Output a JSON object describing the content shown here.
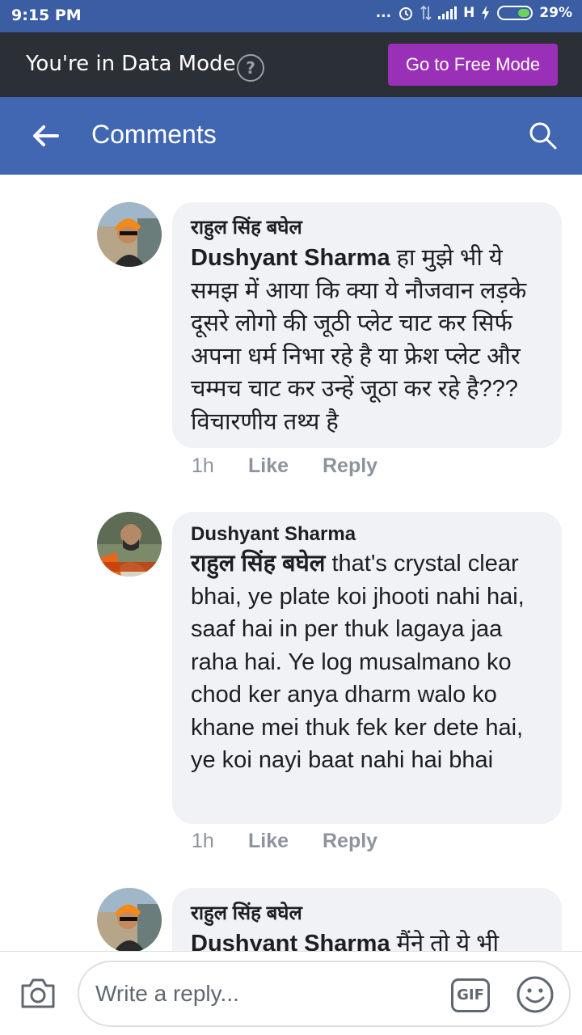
{
  "status_bar": {
    "time": "9:15 PM",
    "dots": "...",
    "network": "H",
    "battery": "29%"
  },
  "data_mode": {
    "text": "You're in Data Mode",
    "help_glyph": "?",
    "button": "Go to Free Mode"
  },
  "header": {
    "title": "Comments"
  },
  "comments": [
    {
      "author": "राहुल सिंह बघेल",
      "mention": "Dushyant Sharma",
      "text": " हा मुझे भी ये समझ में आया कि क्या ये नौजवान लड़के दूसरे लोगो की जूठी प्लेट चाट कर सिर्फ अपना धर्म निभा रहे है या फ्रेश प्लेट और चम्मच चाट कर उन्हें जूठा कर रहे है??? विचारणीय तथ्य है",
      "time": "1h",
      "like": "Like",
      "reply": "Reply"
    },
    {
      "author": "Dushyant Sharma",
      "mention": "राहुल सिंह बघेल",
      "text": " that's crystal clear bhai, ye plate koi jhooti nahi hai, saaf hai in per thuk lagaya jaa raha hai. Ye log musalmano ko chod ker anya dharm walo ko khane mei thuk fek ker dete hai, ye koi nayi baat nahi hai bhai",
      "time": "1h",
      "like": "Like",
      "reply": "Reply"
    },
    {
      "author": "राहुल सिंह बघेल",
      "mention": "Dushyant Sharma",
      "text": " मैंने तो ये भी"
    }
  ],
  "composer": {
    "placeholder": "Write a reply...",
    "gif_label": "GIF"
  },
  "colors": {
    "status_bar": "#3a5da3",
    "data_bar": "#2b2f36",
    "free_button": "#9b30b8",
    "header": "#4267b2",
    "bubble": "#f0f2f5",
    "meta_text": "#8d949e"
  }
}
